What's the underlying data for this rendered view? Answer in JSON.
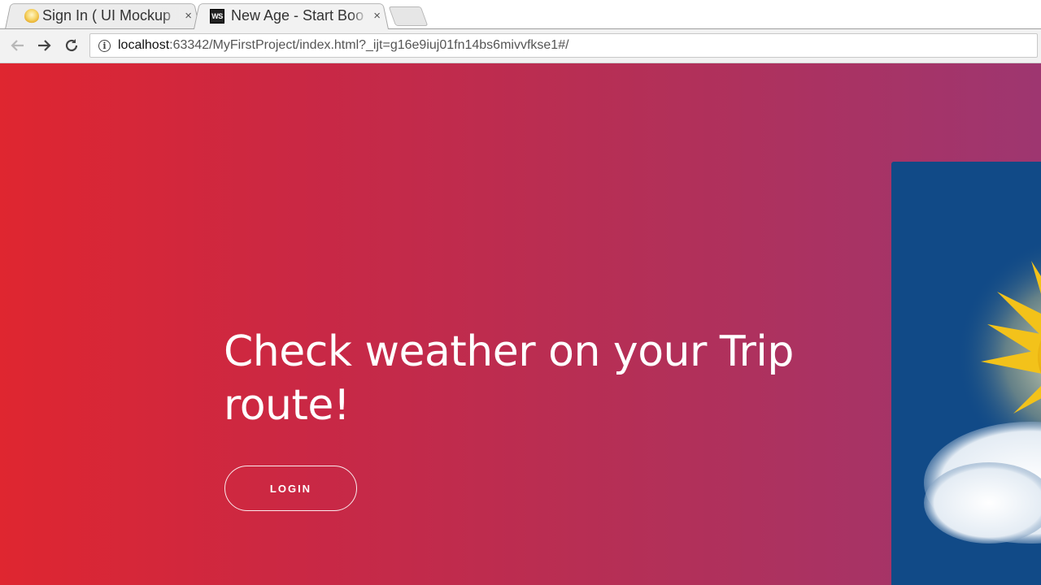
{
  "browser": {
    "tabs": [
      {
        "title": "Sign In ( UI Mockup",
        "icon": "bulb-icon",
        "active": false
      },
      {
        "title": "New Age - Start Boo",
        "icon": "webstorm-icon",
        "active": true
      }
    ],
    "close_glyph": "×",
    "favicon_ws_text": "WS",
    "address": {
      "host": "localhost",
      "rest": ":63342/MyFirstProject/index.html?_ijt=g16e9iuj01fn14bs6mivvfkse1#/"
    }
  },
  "hero": {
    "headline": "Check weather on your Trip route!",
    "login_label": "LOGIN"
  },
  "colors": {
    "gradient_start": "#df2630",
    "gradient_end": "#9e3670",
    "device_screen": "#114a87"
  }
}
